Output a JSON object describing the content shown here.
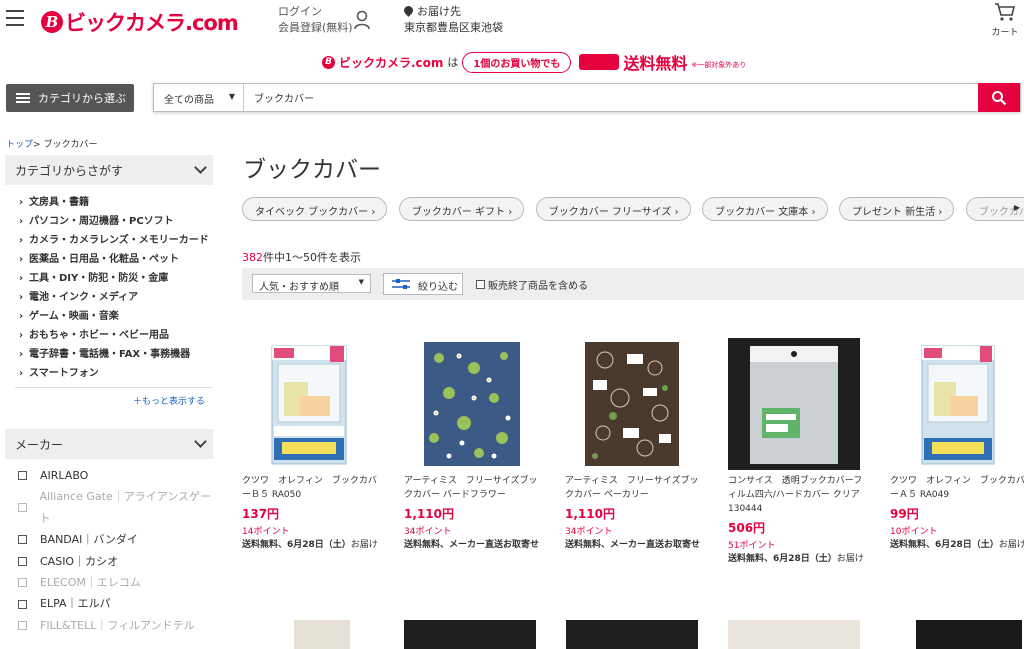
{
  "header": {
    "logo_text": "ビックカメラ.com",
    "login_label": "ログイン",
    "register_label": "会員登録(無料)",
    "delivery_label": "お届け先",
    "delivery_address": "東京都豊島区東池袋",
    "cart_label": "カート"
  },
  "promo": {
    "brand": "ビックカメラ.com",
    "particle": "は",
    "pill": "1個のお買い物でも",
    "free": "送料無料",
    "note": "※一部対象外あり"
  },
  "search": {
    "category_button": "カテゴリから選ぶ",
    "scope": "全ての商品",
    "query": "ブックカバー"
  },
  "breadcrumb": {
    "top": "トップ",
    "sep": ">",
    "current": "ブックカバー"
  },
  "sidebar": {
    "category_heading": "カテゴリからさがす",
    "categories": [
      "文房具・書籍",
      "パソコン・周辺機器・PCソフト",
      "カメラ・カメラレンズ・メモリーカード",
      "医薬品・日用品・化粧品・ペット",
      "工具・DIY・防犯・防災・金庫",
      "電池・インク・メディア",
      "ゲーム・映画・音楽",
      "おもちゃ・ホビー・ベビー用品",
      "電子辞書・電話機・FAX・事務機器",
      "スマートフォン"
    ],
    "more_label": "もっと表示する",
    "maker_heading": "メーカー",
    "makers": [
      {
        "name": "AIRLABO",
        "dim": false
      },
      {
        "name": "Alliance Gate｜アライアンスゲート",
        "dim": true
      },
      {
        "name": "BANDAI｜バンダイ",
        "dim": false
      },
      {
        "name": "CASIO｜カシオ",
        "dim": false
      },
      {
        "name": "ELECOM｜エレコム",
        "dim": true
      },
      {
        "name": "ELPA｜エルパ",
        "dim": false
      },
      {
        "name": "FILL&TELL｜フィルアンドテル",
        "dim": true
      }
    ]
  },
  "main": {
    "title": "ブックカバー",
    "chips": [
      "タイベック ブックカバー",
      "ブックカバー ギフト",
      "ブックカバー フリーサイズ",
      "ブックカバー 文庫本",
      "プレゼント 新生活",
      "ブックカバ..."
    ],
    "count_total": "382",
    "count_text": "件中1～50件を表示",
    "sort_label": "人気・おすすめ順",
    "filter_label": "絞り込む",
    "discontinued_label": "販売終了商品を含める"
  },
  "products": [
    {
      "name": "クツワ　オレフィン　ブックカバーＢ５ RA050",
      "price": "137円",
      "points": "14ポイント",
      "ship_bold": "送料無料、6月28日（土）",
      "ship_rest": "お届け",
      "thumb": "b5"
    },
    {
      "name": "アーティミス　フリーサイズブックカバー バードフラワー",
      "price": "1,110円",
      "points": "34ポイント",
      "ship_bold": "送料無料、メーカー直送お取寄せ",
      "ship_rest": "",
      "thumb": "bird"
    },
    {
      "name": "アーティミス　フリーサイズブックカバー ベーカリー",
      "price": "1,110円",
      "points": "34ポイント",
      "ship_bold": "送料無料、メーカー直送お取寄せ",
      "ship_rest": "",
      "thumb": "bakery"
    },
    {
      "name": "コンサイス　透明ブックカバーフィルム四六/ハードカバー クリア 130444",
      "price": "506円",
      "points": "51ポイント",
      "ship_bold": "送料無料、6月28日（土）",
      "ship_rest": "お届け",
      "thumb": "clear"
    },
    {
      "name": "クツワ　オレフィン　ブックカバーＡ５ RA049",
      "price": "99円",
      "points": "10ポイント",
      "ship_bold": "送料無料、6月28日（土）",
      "ship_rest": "お届け",
      "thumb": "a5"
    }
  ],
  "colors": {
    "brand_red": "#e5003e",
    "link_blue": "#1b62c0"
  }
}
